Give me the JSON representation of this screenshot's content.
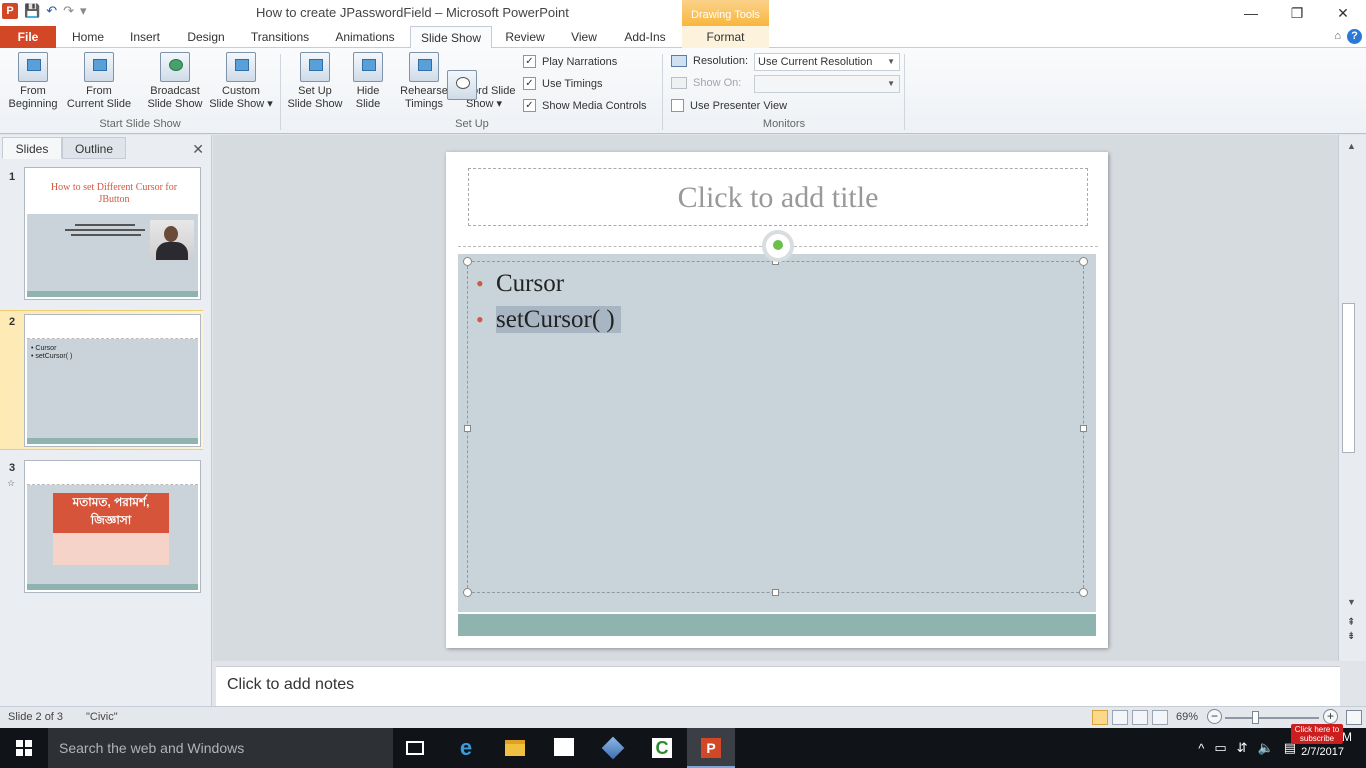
{
  "window": {
    "title": "How to create JPasswordField – Microsoft PowerPoint",
    "app_logo": "P",
    "contextual_tab_group": "Drawing Tools",
    "controls": {
      "minimize": "—",
      "restore": "❐",
      "close": "✕"
    }
  },
  "qat": {
    "save_icon": "save-icon",
    "undo_icon": "undo-icon",
    "redo_icon": "redo-icon",
    "customize_icon": "customize-qat-icon"
  },
  "tabs": [
    {
      "label": "File"
    },
    {
      "label": "Home"
    },
    {
      "label": "Insert"
    },
    {
      "label": "Design"
    },
    {
      "label": "Transitions"
    },
    {
      "label": "Animations"
    },
    {
      "label": "Slide Show"
    },
    {
      "label": "Review"
    },
    {
      "label": "View"
    },
    {
      "label": "Add-Ins"
    },
    {
      "label": "Format"
    }
  ],
  "active_tab": "Slide Show",
  "ribbon": {
    "start_group": {
      "label": "Start Slide Show",
      "from_beginning": [
        "From",
        "Beginning"
      ],
      "from_current": [
        "From",
        "Current Slide"
      ],
      "broadcast": [
        "Broadcast",
        "Slide Show"
      ],
      "custom": [
        "Custom",
        "Slide Show ▾"
      ]
    },
    "setup_group": {
      "label": "Set Up",
      "setup": [
        "Set Up",
        "Slide Show"
      ],
      "hide": [
        "Hide",
        "Slide"
      ],
      "rehearse": [
        "Rehearse",
        "Timings"
      ],
      "record": [
        "Record Slide",
        "Show ▾"
      ],
      "play_narrations": "Play Narrations",
      "use_timings": "Use Timings",
      "show_media_controls": "Show Media Controls",
      "play_narrations_checked": true,
      "use_timings_checked": true,
      "show_media_controls_checked": true
    },
    "monitors_group": {
      "label": "Monitors",
      "resolution_label": "Resolution:",
      "resolution_value": "Use Current Resolution",
      "show_on_label": "Show On:",
      "show_on_value": "",
      "presenter_view": "Use Presenter View",
      "presenter_view_checked": false
    }
  },
  "left_pane": {
    "tab_slides": "Slides",
    "tab_outline": "Outline",
    "close": "✕",
    "slides": [
      {
        "num": "1",
        "title": "How to set Different Cursor for JButton"
      },
      {
        "num": "2",
        "bullets": [
          "Cursor",
          "setCursor( )"
        ]
      },
      {
        "num": "3",
        "title": "মতামত, পরামর্শ, জিজ্ঞাসা"
      }
    ],
    "selected_slide": 2
  },
  "slide": {
    "title_placeholder": "Click to add title",
    "bullets": [
      "Cursor",
      "setCursor( )"
    ]
  },
  "notes": {
    "placeholder": "Click to add notes"
  },
  "status": {
    "slide_info": "Slide 2 of 3",
    "theme": "\"Civic\"",
    "zoom": "69%",
    "zoom_value": 69
  },
  "taskbar": {
    "search_placeholder": "Search the web and Windows",
    "time_fragment": "M",
    "date": "2/7/2017",
    "subscribe": "Click here to subscribe"
  },
  "colors": {
    "file_tab": "#d24726",
    "accent_bullet": "#d2583e",
    "slide_body": "#c9d4da",
    "slide_footer": "#8fb3ae",
    "drawing_tools": "#f8b63c"
  }
}
